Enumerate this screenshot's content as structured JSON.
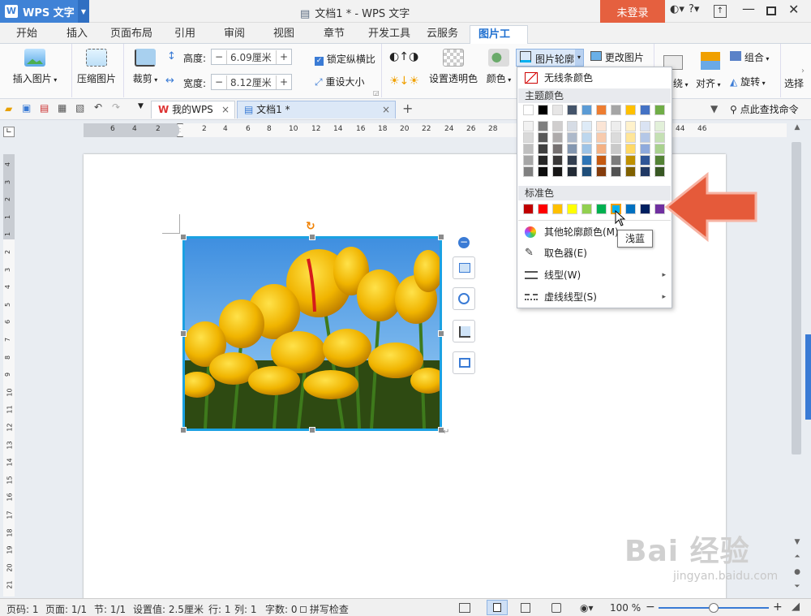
{
  "app": {
    "name": "WPS 文字",
    "doc_title": "文档1 * - WPS 文字",
    "login_label": "未登录"
  },
  "titlebar": {
    "help": "?",
    "menu": "▾"
  },
  "tabs": [
    "开始",
    "插入",
    "页面布局",
    "引用",
    "审阅",
    "视图",
    "章节",
    "开发工具",
    "云服务",
    "图片工具"
  ],
  "active_tab": "图片工具",
  "ribbon": {
    "insert_pic": "插入图片",
    "compress_pic": "压缩图片",
    "crop": "裁剪",
    "height_label": "高度:",
    "height_value": "6.09厘米",
    "width_label": "宽度:",
    "width_value": "8.12厘米",
    "lock_ratio": "锁定纵横比",
    "reset_size": "重设大小",
    "set_transparent": "设置透明色",
    "color": "颜色",
    "outline": "图片轮廓",
    "change_pic": "更改图片",
    "wrap": "绕",
    "align": "对齐",
    "group": "组合",
    "rotate": "旋转",
    "select": "选择"
  },
  "qbar": {
    "mywps_tab": "我的WPS",
    "doc_tab": "文档1 *",
    "add_tab": "+",
    "search": "点此查找命令"
  },
  "ruler": {
    "h_ticks": [
      "6",
      "4",
      "2",
      "2",
      "4",
      "6",
      "8",
      "10",
      "12",
      "14",
      "16",
      "18",
      "20",
      "22",
      "24",
      "26",
      "28",
      "44",
      "46"
    ],
    "v_ticks": [
      "4",
      "3",
      "2",
      "1",
      "1",
      "2",
      "3",
      "4",
      "5",
      "6",
      "7",
      "8",
      "9",
      "10",
      "11",
      "12",
      "13",
      "14",
      "15",
      "16",
      "17",
      "18",
      "19",
      "20",
      "21"
    ]
  },
  "dropdown": {
    "no_line": "无线条颜色",
    "theme_header": "主题颜色",
    "standard_header": "标准色",
    "other_colors": "其他轮廓颜色(M)...",
    "eyedropper": "取色器(E)",
    "line_style": "线型(W)",
    "dash_style": "虚线线型(S)",
    "theme_top": [
      "#ffffff",
      "#000000",
      "#e7e6e6",
      "#44546a",
      "#5b9bd5",
      "#ed7d31",
      "#a5a5a5",
      "#ffc000",
      "#4472c4",
      "#70ad47"
    ],
    "theme_shades": [
      [
        "#f2f2f2",
        "#7f7f7f",
        "#d0cece",
        "#d6dce5",
        "#deebf7",
        "#fbe5d6",
        "#ededed",
        "#fff2cc",
        "#dae3f3",
        "#e2f0d9"
      ],
      [
        "#d9d9d9",
        "#595959",
        "#aeabab",
        "#adb9ca",
        "#bdd7ee",
        "#f8cbad",
        "#dbdbdb",
        "#ffe699",
        "#b4c7e7",
        "#c5e0b4"
      ],
      [
        "#bfbfbf",
        "#404040",
        "#767171",
        "#8497b0",
        "#9dc3e6",
        "#f4b183",
        "#c9c9c9",
        "#ffd966",
        "#8faadc",
        "#a9d18e"
      ],
      [
        "#a6a6a6",
        "#262626",
        "#3a3838",
        "#333f50",
        "#2e75b6",
        "#c55a11",
        "#7b7b7b",
        "#bf9000",
        "#2f5597",
        "#548235"
      ],
      [
        "#808080",
        "#0d0d0d",
        "#171616",
        "#222a35",
        "#1f4e79",
        "#843c0c",
        "#525252",
        "#7f6000",
        "#203864",
        "#385723"
      ]
    ],
    "standard": [
      "#c00000",
      "#ff0000",
      "#ffc000",
      "#ffff00",
      "#92d050",
      "#00b050",
      "#00b0f0",
      "#0070c0",
      "#002060",
      "#7030a0"
    ],
    "selected_standard_index": 6
  },
  "tooltip": "浅蓝",
  "status": {
    "page": "页码: 1",
    "pages": "页面: 1/1",
    "section": "节: 1/1",
    "setting": "设置值: 2.5厘米",
    "row": "行: 1",
    "col": "列: 1",
    "words": "字数: 0",
    "spell": "拼写检查",
    "zoom": "100 %",
    "zoom_level": 0.5
  },
  "watermark": {
    "brand": "Bai 经验",
    "url": "jingyan.baidu.com"
  }
}
